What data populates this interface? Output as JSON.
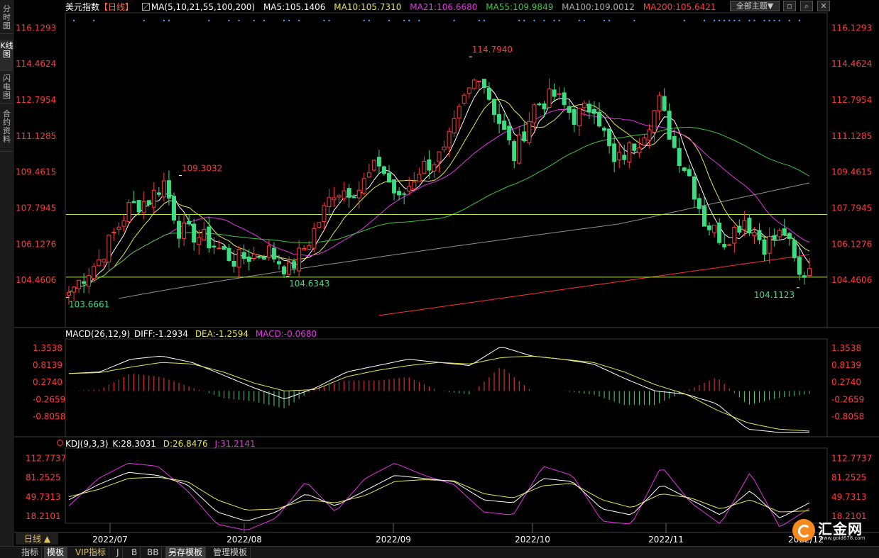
{
  "left_tabs": [
    {
      "label": "分时图",
      "active": false
    },
    {
      "label": "K线图",
      "active": true
    },
    {
      "label": "闪电图",
      "active": false
    },
    {
      "label": "合约资料",
      "active": false
    }
  ],
  "header": {
    "instrument": "美元指数",
    "period_tag": "【日线】",
    "ma_params": "MA(5,10,21,55,100,200)",
    "ma5": "MA5:105.1406",
    "ma10": "MA10:105.7310",
    "ma21": "MA21:106.6680",
    "ma55": "MA55:109.9849",
    "ma100": "MA100:109.0012",
    "ma200": "MA200:105.6421",
    "theme_button": "全部主题▼"
  },
  "colors": {
    "up": "#ff3c3c",
    "down": "#3cdc82",
    "ma5": "#ffffff",
    "ma10": "#e6e650",
    "ma21": "#e632e6",
    "ma55": "#3cc83c",
    "ma100": "#909090",
    "ma200": "#ff3232",
    "axis_text": "#ff3c3c"
  },
  "macd": {
    "label": "MACD(26,12,9)",
    "diff": "DIFF:-1.2934",
    "dea": "DEA:-1.2594",
    "macd": "MACD:-0.0680"
  },
  "kdj": {
    "label": "KDJ(9,3,3)",
    "k": "K:28.3031",
    "d": "D:26.8476",
    "j": "J:31.2141"
  },
  "period_button": "日线 ▲",
  "bottom_tabs": [
    {
      "label": "指标",
      "selected": false
    },
    {
      "label": "模板",
      "selected": true
    },
    {
      "label": "VIP指标",
      "selected": false
    },
    {
      "label": "J",
      "selected": false
    },
    {
      "label": "B",
      "selected": false
    },
    {
      "label": "BB",
      "selected": false
    },
    {
      "label": "另存模板",
      "selected": true
    },
    {
      "label": "管理模板",
      "selected": false
    }
  ],
  "logo": {
    "name": "汇金网",
    "url": "www.gold678.com"
  },
  "chart_data": [
    {
      "type": "candlestick",
      "title": "美元指数 日线",
      "y_ticks": [
        116.1293,
        114.4624,
        112.7954,
        111.1285,
        109.4615,
        107.7945,
        106.1276,
        104.4606
      ],
      "ylim": [
        102.4,
        116.7
      ],
      "x_ticks": [
        "2022/07",
        "2022/08",
        "2022/09",
        "2022/10",
        "2022/11",
        "2022/12"
      ],
      "annotations": [
        {
          "label": "109.3032",
          "kind": "high"
        },
        {
          "label": "114.7940",
          "kind": "high"
        },
        {
          "label": "103.6661",
          "kind": "low"
        },
        {
          "label": "104.6343",
          "kind": "low"
        },
        {
          "label": "104.1123",
          "kind": "low"
        }
      ],
      "horizontal_lines": [
        107.5,
        104.6
      ],
      "anchors": [
        {
          "i": 0,
          "c": 103.9
        },
        {
          "i": 6,
          "c": 105.4
        },
        {
          "i": 12,
          "c": 107.8
        },
        {
          "i": 16,
          "c": 108.2
        },
        {
          "i": 19,
          "c": 109.0
        },
        {
          "i": 22,
          "c": 106.8
        },
        {
          "i": 27,
          "c": 106.4
        },
        {
          "i": 33,
          "c": 105.4
        },
        {
          "i": 40,
          "c": 105.8
        },
        {
          "i": 44,
          "c": 104.9
        },
        {
          "i": 48,
          "c": 106.3
        },
        {
          "i": 53,
          "c": 108.6
        },
        {
          "i": 58,
          "c": 108.7
        },
        {
          "i": 62,
          "c": 109.9
        },
        {
          "i": 66,
          "c": 108.1
        },
        {
          "i": 70,
          "c": 109.6
        },
        {
          "i": 75,
          "c": 110.3
        },
        {
          "i": 79,
          "c": 112.8
        },
        {
          "i": 82,
          "c": 114.1
        },
        {
          "i": 86,
          "c": 111.8
        },
        {
          "i": 89,
          "c": 110.2
        },
        {
          "i": 93,
          "c": 112.5
        },
        {
          "i": 97,
          "c": 113.0
        },
        {
          "i": 101,
          "c": 112.0
        },
        {
          "i": 105,
          "c": 112.6
        },
        {
          "i": 109,
          "c": 109.8
        },
        {
          "i": 114,
          "c": 111.0
        },
        {
          "i": 118,
          "c": 112.7
        },
        {
          "i": 121,
          "c": 110.6
        },
        {
          "i": 124,
          "c": 109.3
        },
        {
          "i": 127,
          "c": 107.2
        },
        {
          "i": 131,
          "c": 106.3
        },
        {
          "i": 135,
          "c": 107.3
        },
        {
          "i": 139,
          "c": 106.1
        },
        {
          "i": 143,
          "c": 106.7
        },
        {
          "i": 146,
          "c": 104.6
        },
        {
          "i": 148,
          "c": 105.0
        }
      ],
      "ma_end": {
        "ma5": 105.1406,
        "ma10": 105.731,
        "ma21": 106.668,
        "ma55": 109.9849,
        "ma100": 109.0012,
        "ma200": 105.6421
      }
    },
    {
      "type": "macd",
      "y_ticks": [
        1.3538,
        0.8139,
        0.274,
        -0.2659,
        -0.8058
      ],
      "ylim": [
        -1.35,
        1.55
      ],
      "diff_anchors": [
        0.55,
        0.6,
        1.0,
        1.1,
        0.9,
        0.5,
        0.1,
        -0.25,
        0.1,
        0.6,
        0.8,
        1.0,
        0.9,
        0.8,
        1.4,
        1.1,
        1.0,
        0.85,
        0.4,
        0.0,
        -0.1,
        -0.4,
        -1.2,
        -1.3,
        -1.3
      ],
      "dea_anchors": [
        0.55,
        0.58,
        0.75,
        0.9,
        0.85,
        0.6,
        0.25,
        0.0,
        0.05,
        0.45,
        0.65,
        0.8,
        0.9,
        0.85,
        1.05,
        1.1,
        1.0,
        0.9,
        0.6,
        0.2,
        -0.1,
        -0.6,
        -1.0,
        -1.2,
        -1.26
      ]
    },
    {
      "type": "kdj",
      "y_ticks": [
        112.7737,
        81.2525,
        49.7313,
        18.2101
      ],
      "ylim": [
        -5,
        125
      ],
      "k_anchors": [
        45,
        70,
        90,
        85,
        70,
        25,
        10,
        25,
        55,
        35,
        60,
        85,
        80,
        75,
        45,
        40,
        80,
        75,
        30,
        20,
        70,
        45,
        20,
        60,
        15,
        40
      ],
      "d_anchors": [
        50,
        62,
        80,
        82,
        75,
        45,
        28,
        30,
        45,
        40,
        52,
        75,
        78,
        76,
        55,
        48,
        68,
        72,
        45,
        32,
        55,
        48,
        30,
        45,
        25,
        27
      ],
      "j_anchors": [
        35,
        80,
        105,
        100,
        60,
        5,
        -5,
        15,
        75,
        25,
        80,
        105,
        85,
        70,
        25,
        20,
        100,
        85,
        10,
        5,
        100,
        40,
        5,
        90,
        0,
        31
      ]
    }
  ]
}
